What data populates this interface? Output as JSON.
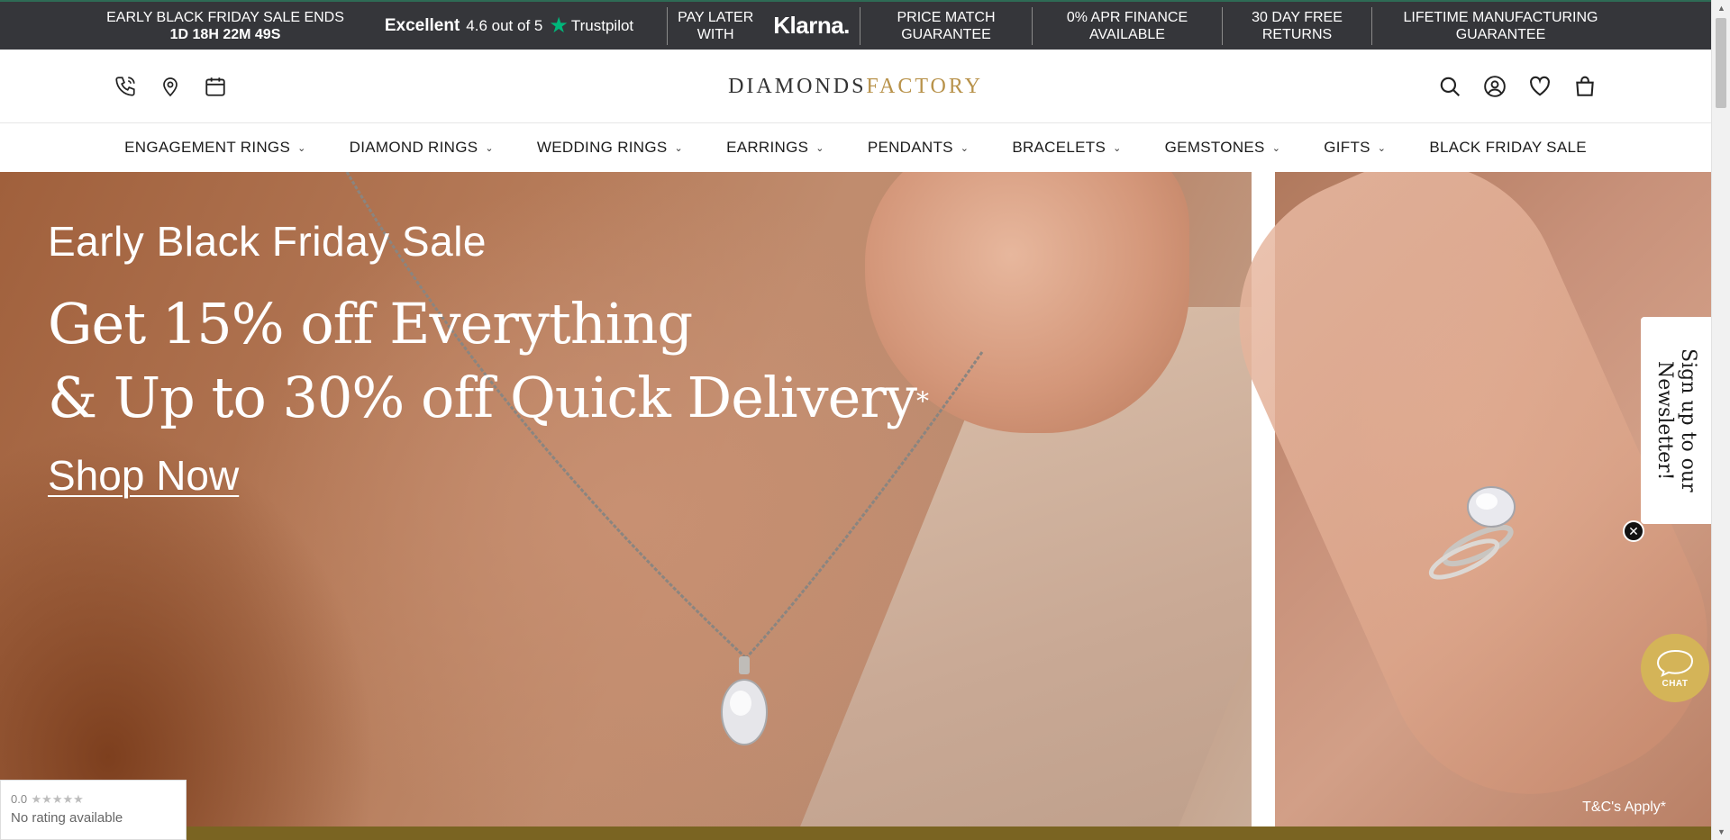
{
  "topbar": {
    "countdown_label": "EARLY BLACK FRIDAY SALE ENDS",
    "countdown_value": "1D 18H 22M 49S",
    "trustpilot_excellent": "Excellent",
    "trustpilot_rating": "4.6 out of 5",
    "trustpilot_brand": "Trustpilot",
    "klarna_line1": "PAY LATER",
    "klarna_line2": "WITH",
    "klarna_logo": "Klarna.",
    "price_match_line1": "PRICE MATCH",
    "price_match_line2": "GUARANTEE",
    "apr_line1": "0% APR FINANCE",
    "apr_line2": "AVAILABLE",
    "returns_line1": "30 DAY FREE",
    "returns_line2": "RETURNS",
    "lifetime_line1": "LIFETIME MANUFACTURING",
    "lifetime_line2": "GUARANTEE"
  },
  "header": {
    "logo_part1": "DIAMONDS",
    "logo_part2": "FACTORY",
    "left_icons": [
      "phone-icon",
      "location-pin-icon",
      "calendar-icon"
    ],
    "right_icons": [
      "search-icon",
      "account-icon",
      "wishlist-heart-icon",
      "cart-bag-icon"
    ]
  },
  "nav": {
    "items": [
      {
        "label": "ENGAGEMENT RINGS",
        "has_dropdown": true
      },
      {
        "label": "DIAMOND RINGS",
        "has_dropdown": true
      },
      {
        "label": "WEDDING RINGS",
        "has_dropdown": true
      },
      {
        "label": "EARRINGS",
        "has_dropdown": true
      },
      {
        "label": "PENDANTS",
        "has_dropdown": true
      },
      {
        "label": "BRACELETS",
        "has_dropdown": true
      },
      {
        "label": "GEMSTONES",
        "has_dropdown": true
      },
      {
        "label": "GIFTS",
        "has_dropdown": true
      },
      {
        "label": "BLACK FRIDAY SALE",
        "has_dropdown": false
      }
    ]
  },
  "hero": {
    "subtitle": "Early Black Friday Sale",
    "headline_line1": "Get 15% off Everything",
    "headline_line2": "& Up to 30% off Quick Delivery",
    "headline_asterisk": "*",
    "cta": "Shop Now",
    "terms": "T&C's Apply*"
  },
  "newsletter": {
    "label": "Sign up to our Newsletter!",
    "close_icon": "close-icon"
  },
  "chat": {
    "label": "CHAT",
    "color": "#d4b458"
  },
  "rating_widget": {
    "score": "0.0",
    "stars": "★★★★★",
    "text": "No rating available"
  },
  "colors": {
    "topbar_bg": "#35363a",
    "logo_gold": "#b8924a",
    "trustpilot_green": "#00b67a",
    "bottom_bar": "#7a6422"
  }
}
